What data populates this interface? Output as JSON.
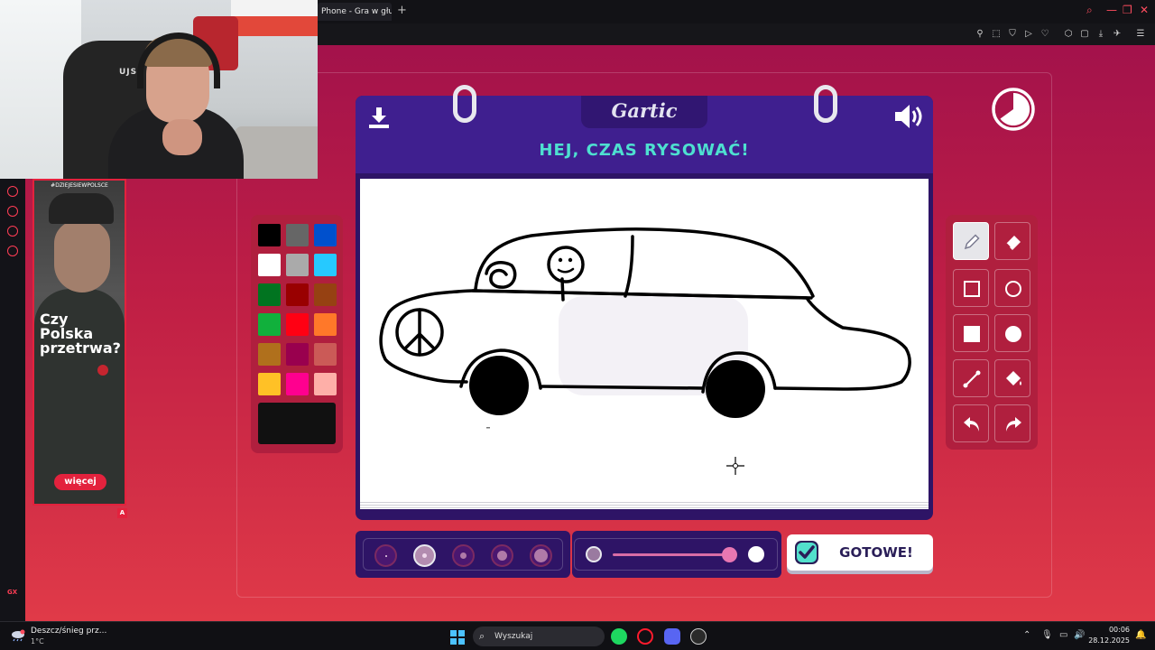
{
  "browser": {
    "tab_title": "Phone - Gra w głuc",
    "new_tab": "+"
  },
  "stream": {
    "webcam_brand": "UJSA",
    "ad": {
      "hashtag": "#DZIEJESIEWPOLSCE",
      "headline": "Czy Polska przetrwa?",
      "headline_lines": [
        "Czy",
        "Polska",
        "przetrwa?"
      ],
      "button": "więcej",
      "badge": "A"
    }
  },
  "game": {
    "logo": "Gartic",
    "prompt": "HEJ, CZAS RYSOWAĆ!",
    "done_button": "GOTOWE!",
    "palette": {
      "colors": [
        "#000000",
        "#666666",
        "#0050cd",
        "#ffffff",
        "#aaaaaa",
        "#26c9ff",
        "#017420",
        "#990000",
        "#964112",
        "#11b03c",
        "#ff0013",
        "#ff7829",
        "#b0701c",
        "#99004e",
        "#cb5a57",
        "#ffc126",
        "#ff008f",
        "#feafa8"
      ],
      "current_color": "#111111"
    },
    "tools": [
      "pencil",
      "eraser",
      "rectangle-outline",
      "ellipse-outline",
      "rectangle-filled",
      "ellipse-filled",
      "line",
      "fill-bucket",
      "undo",
      "redo"
    ],
    "active_tool": "pencil",
    "brush_sizes": 5,
    "selected_brush_size": 2,
    "opacity_level": 0.95,
    "icons": {
      "download": "download-icon",
      "volume": "volume-icon",
      "timer": "timer-icon",
      "done": "check-icon"
    }
  },
  "taskbar": {
    "weather_text": "Deszcz/śnieg prz...",
    "temperature": "1°C",
    "search_placeholder": "Wyszukaj",
    "time": "00:06",
    "date": "28.12.2025"
  }
}
